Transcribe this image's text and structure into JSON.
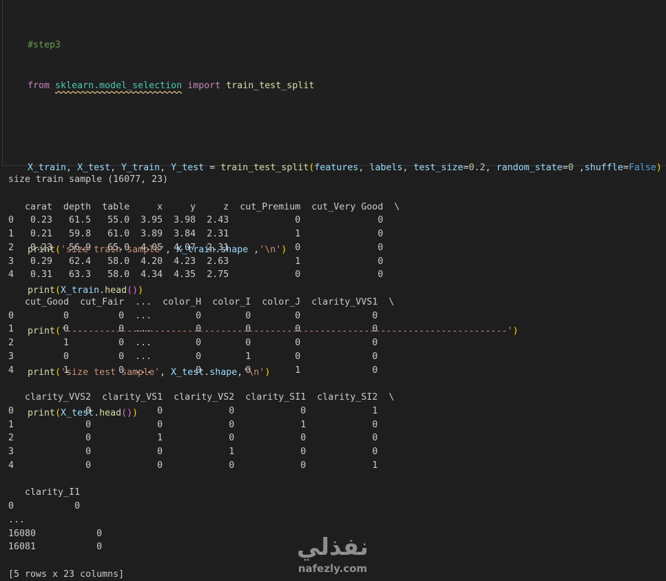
{
  "code_cell": {
    "lines": [
      "#step3",
      "from sklearn.model_selection import train_test_split",
      "",
      "X_train, X_test, Y_train, Y_test = train_test_split(features, labels, test_size=0.2, random_state=0 ,shuffle=False)",
      "",
      "print('size train sample', X_train.shape ,'\\n')",
      "print(X_train.head())",
      "print('--------------------------------------------------------------------------------')",
      "print('size test sample', X_test.shape,'\\n')",
      "print(X_test.head())"
    ]
  },
  "output": {
    "lines": [
      "size train sample (16077, 23)",
      "",
      "   carat  depth  table     x     y     z  cut_Premium  cut_Very Good  \\",
      "0   0.23   61.5   55.0  3.95  3.98  2.43            0              0",
      "1   0.21   59.8   61.0  3.89  3.84  2.31            1              0",
      "2   0.23   56.9   65.0  4.05  4.07  2.31            0              0",
      "3   0.29   62.4   58.0  4.20  4.23  2.63            1              0",
      "4   0.31   63.3   58.0  4.34  4.35  2.75            0              0",
      "",
      "   cut_Good  cut_Fair  ...  color_H  color_I  color_J  clarity_VVS1  \\",
      "0         0         0  ...        0        0        0             0",
      "1         0         0  ...        0        0        0             0",
      "2         1         0  ...        0        0        0             0",
      "3         0         0  ...        0        1        0             0",
      "4         1         0  ...        0        0        1             0",
      "",
      "   clarity_VVS2  clarity_VS1  clarity_VS2  clarity_SI1  clarity_SI2  \\",
      "0             0            0            0            0            1",
      "1             0            0            0            1            0",
      "2             0            1            0            0            0",
      "3             0            0            1            0            0",
      "4             0            0            0            0            1",
      "",
      "   clarity_I1",
      "0           0",
      "...",
      "16080           0",
      "16081           0",
      "",
      "[5 rows x 23 columns]"
    ]
  },
  "watermark": {
    "arabic": "نفذلي",
    "latin": "nafezly.com"
  }
}
